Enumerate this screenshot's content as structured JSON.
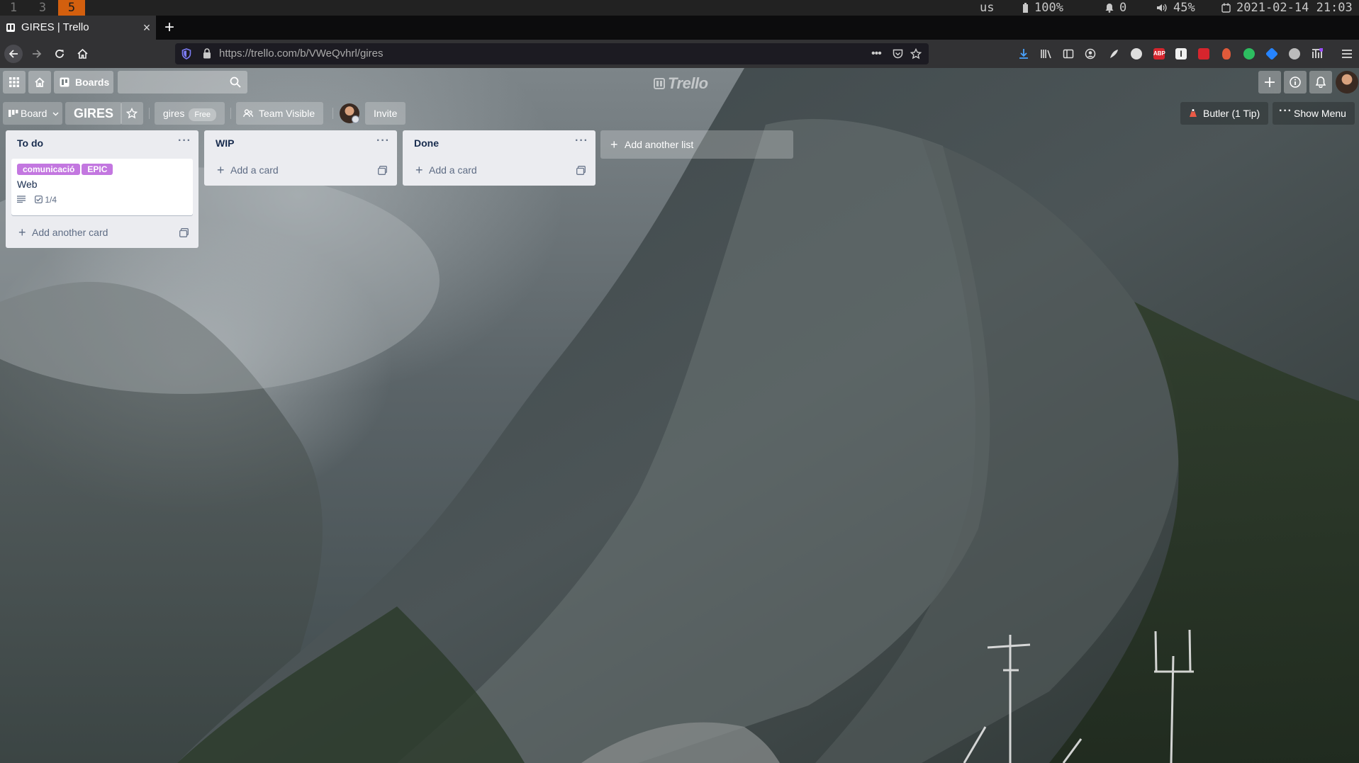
{
  "system_bar": {
    "workspaces": [
      {
        "num": "1",
        "active": false
      },
      {
        "num": "3",
        "active": false
      },
      {
        "num": "5",
        "active": true
      }
    ],
    "keyboard_layout": "us",
    "battery": "100%",
    "notifications": "0",
    "volume": "45%",
    "datetime": "2021-02-14 21:03"
  },
  "browser": {
    "tab_title": "GIRES | Trello",
    "tab_close": "×",
    "new_tab": "+",
    "url_host": "https://trello.com",
    "url_path": "/b/VWeQvhrl/gires",
    "url_more": "•••"
  },
  "trello_header": {
    "boards_label": "Boards",
    "logo_text": "Trello"
  },
  "board_header": {
    "view_label": "Board",
    "board_title": "GIRES",
    "team_name": "gires",
    "team_plan": "Free",
    "visibility_label": "Team Visible",
    "invite_label": "Invite",
    "butler_label": "Butler (1 Tip)",
    "show_menu_label": "Show Menu"
  },
  "lists": [
    {
      "title": "To do",
      "cards": [
        {
          "labels": [
            "comunicació",
            "EPIC"
          ],
          "title": "Web",
          "checklist": "1/4"
        }
      ],
      "add_label": "Add another card"
    },
    {
      "title": "WIP",
      "cards": [],
      "add_label": "Add a card"
    },
    {
      "title": "Done",
      "cards": [],
      "add_label": "Add a card"
    }
  ],
  "add_list_label": "Add another list",
  "colors": {
    "accent_workspace": "#d35f0e",
    "label_purple": "#c377e0",
    "list_bg": "#ebecf0"
  }
}
